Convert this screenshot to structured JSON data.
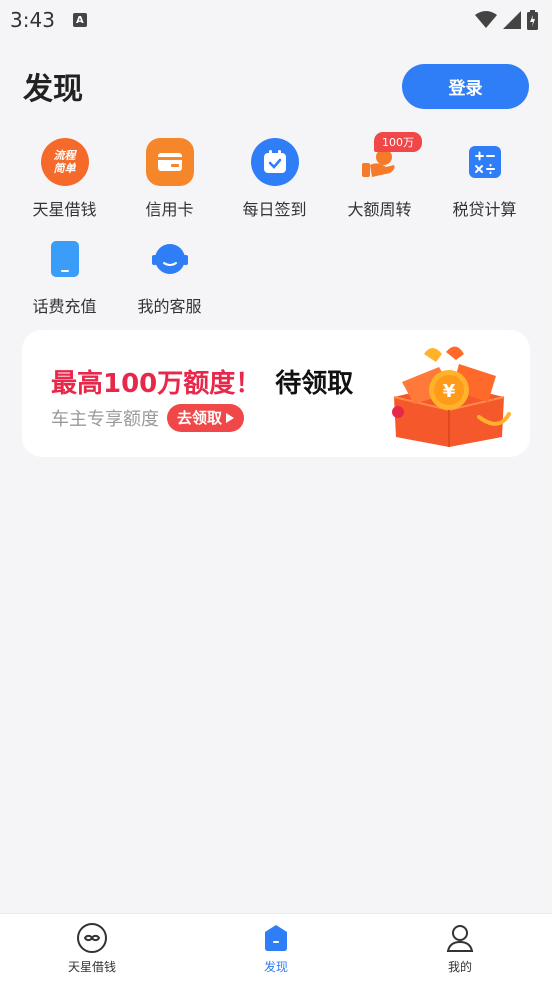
{
  "status_bar": {
    "time": "3:43",
    "notif_letter": "A"
  },
  "header": {
    "title": "发现",
    "login_label": "登录"
  },
  "grid": [
    {
      "label": "天星借钱",
      "icon": "process-simple-icon",
      "icon_text_1": "流程",
      "icon_text_2": "简单",
      "color": "#f56a2a"
    },
    {
      "label": "信用卡",
      "icon": "card-icon",
      "color": "#f5862a"
    },
    {
      "label": "每日签到",
      "icon": "calendar-check-icon",
      "color": "#2f7df7"
    },
    {
      "label": "大额周转",
      "icon": "loan-hand-icon",
      "badge": "100万",
      "color": "#f57a2a"
    },
    {
      "label": "税贷计算",
      "icon": "calculator-icon",
      "color": "#2f7df7"
    },
    {
      "label": "话费充值",
      "icon": "phone-icon",
      "color": "#3a9df7"
    },
    {
      "label": "我的客服",
      "icon": "headset-icon",
      "color": "#2f7df7"
    }
  ],
  "banner": {
    "title_red": "最高100万额度！",
    "title_dark": "待领取",
    "subtitle": "车主专享额度",
    "cta": "去领取",
    "art": "gift-box-icon"
  },
  "tabbar": [
    {
      "label": "天星借钱",
      "icon": "link-icon",
      "active": false
    },
    {
      "label": "发现",
      "icon": "discover-icon",
      "active": true
    },
    {
      "label": "我的",
      "icon": "user-icon",
      "active": false
    }
  ],
  "colors": {
    "accent": "#2f7df7",
    "red": "#e8284a",
    "background": "#f5f5f7"
  }
}
